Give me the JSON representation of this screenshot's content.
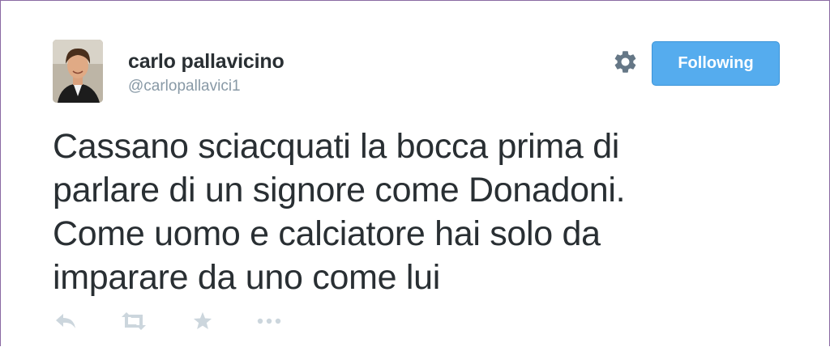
{
  "user": {
    "name": "carlo pallavicino",
    "handle": "@carlopallavici1"
  },
  "follow_button": {
    "label": "Following"
  },
  "tweet": {
    "lines": [
      "Cassano sciacquati la bocca prima di",
      "parlare di un signore come Donadoni.",
      "Come uomo e calciatore hai solo da",
      "imparare da uno come lui"
    ]
  },
  "actions": [
    {
      "icon": "reply-icon"
    },
    {
      "icon": "retweet-icon"
    },
    {
      "icon": "favorite-icon"
    },
    {
      "icon": "more-icon"
    }
  ],
  "colors": {
    "accent": "#55acee",
    "text": "#292f33",
    "muted": "#8899a6",
    "icon": "#ccd6dd",
    "border": "#8a6aa3"
  }
}
